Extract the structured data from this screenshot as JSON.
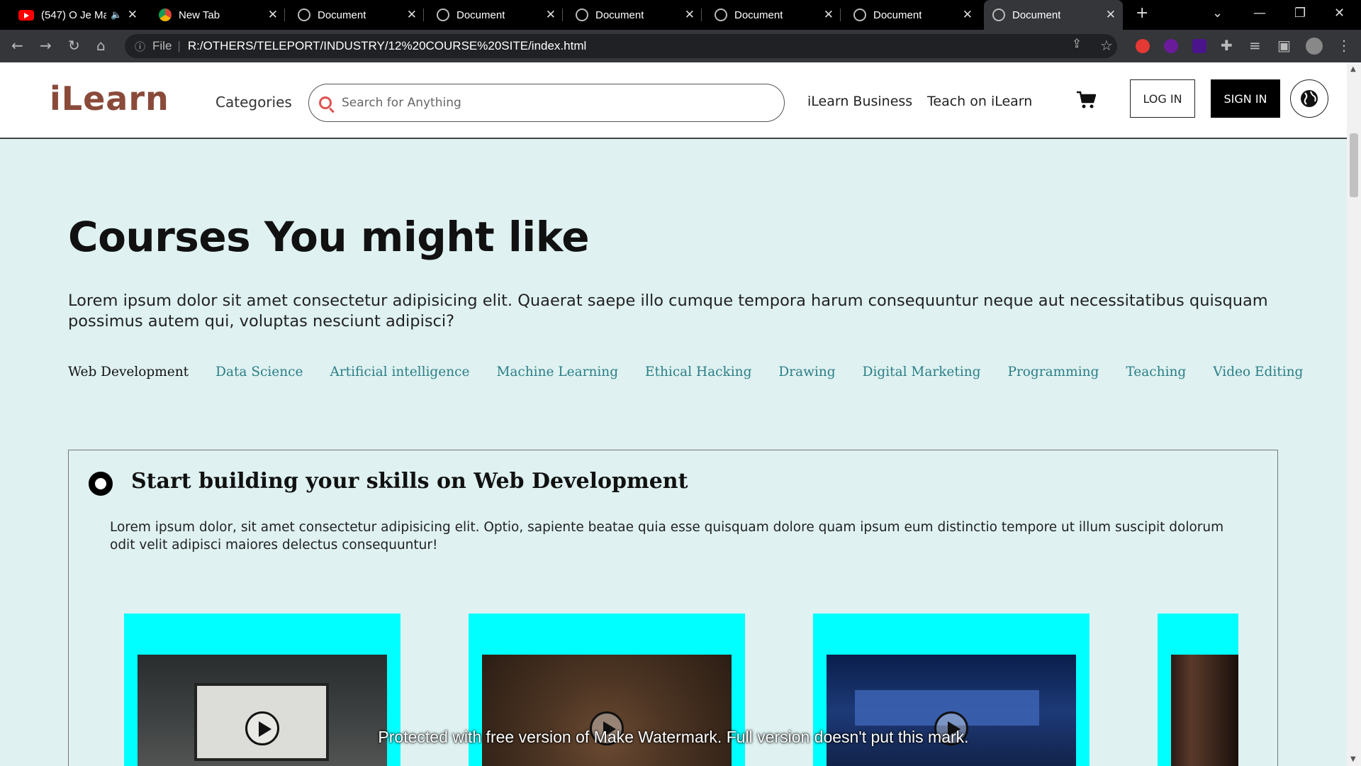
{
  "browser": {
    "tabs": [
      {
        "title": "(547) O Je Ma",
        "icon": "youtube-icon",
        "active": false
      },
      {
        "title": "New Tab",
        "icon": "chrome-icon",
        "active": false
      },
      {
        "title": "Document",
        "icon": "globe-icon",
        "active": false
      },
      {
        "title": "Document",
        "icon": "globe-icon",
        "active": false
      },
      {
        "title": "Document",
        "icon": "globe-icon",
        "active": false
      },
      {
        "title": "Document",
        "icon": "globe-icon",
        "active": false
      },
      {
        "title": "Document",
        "icon": "globe-icon",
        "active": false
      },
      {
        "title": "Document",
        "icon": "globe-icon",
        "active": true
      }
    ],
    "address": {
      "scheme": "File",
      "url": "R:/OTHERS/TELEPORT/INDUSTRY/12%20COURSE%20SITE/index.html"
    }
  },
  "header": {
    "logo": "iLearn",
    "categories": "Categories",
    "search_placeholder": "Search for Anything",
    "business": "iLearn Business",
    "teach": "Teach on iLearn",
    "login": "LOG IN",
    "signin": "SIGN IN"
  },
  "main": {
    "title": "Courses You might like",
    "intro": "Lorem ipsum dolor sit amet consectetur adipisicing elit. Quaerat saepe illo cumque tempora harum consequuntur neque aut necessitatibus quisquam possimus autem qui, voluptas nesciunt adipisci?",
    "topics": [
      {
        "label": "Web Development",
        "active": true
      },
      {
        "label": "Data Science",
        "active": false
      },
      {
        "label": "Artificial intelligence",
        "active": false
      },
      {
        "label": "Machine Learning",
        "active": false
      },
      {
        "label": "Ethical Hacking",
        "active": false
      },
      {
        "label": "Drawing",
        "active": false
      },
      {
        "label": "Digital Marketing",
        "active": false
      },
      {
        "label": "Programming",
        "active": false
      },
      {
        "label": "Teaching",
        "active": false
      },
      {
        "label": "Video Editing",
        "active": false
      }
    ],
    "panel": {
      "title": "Start building your skills on Web Development",
      "description": "Lorem ipsum dolor, sit amet consectetur adipisicing elit. Optio, sapiente beatae quia esse quisquam dolore quam ipsum eum distinctio tempore ut illum suscipit dolorum odit velit adipisci maiores delectus consequuntur!"
    }
  },
  "watermark": "Protected with free version of Make Watermark. Full version doesn't put this mark.",
  "colors": {
    "page_bg": "#dff1f1",
    "logo": "#8a4a3a",
    "topic_link": "#2b7f86",
    "card_bg": "#00ffff",
    "search_icon": "#e05252"
  }
}
